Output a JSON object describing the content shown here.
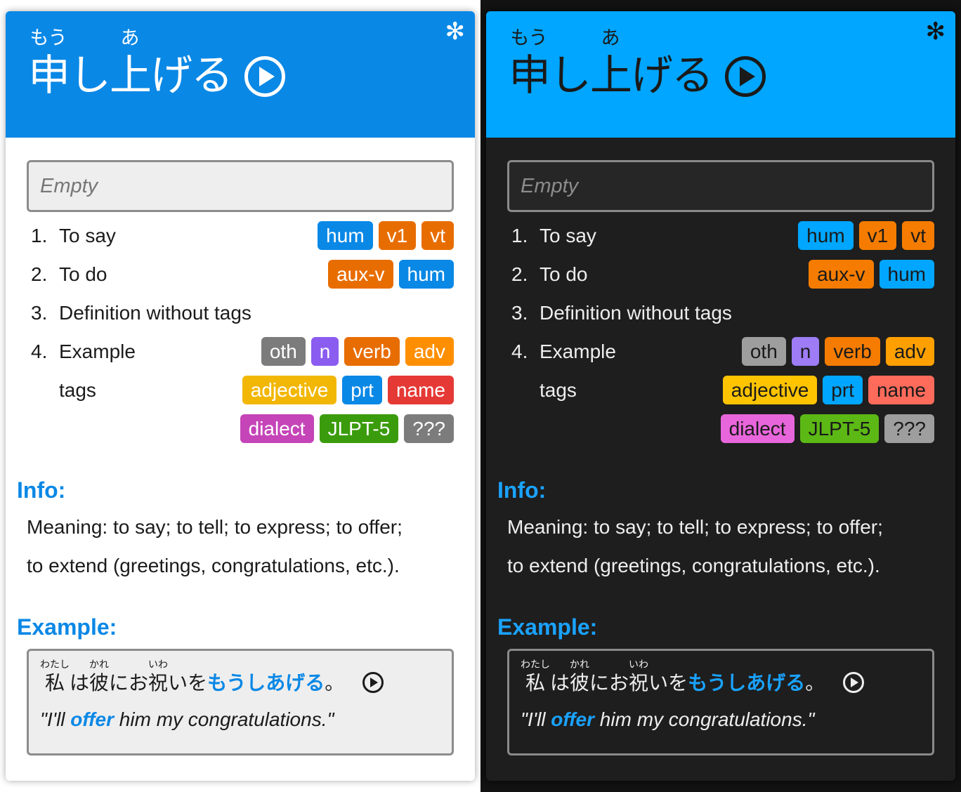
{
  "header": {
    "settings_icon": "✻",
    "word_groups": [
      {
        "furigana": "もう",
        "text": "申"
      },
      {
        "furigana": "",
        "text": "し"
      },
      {
        "furigana": "あ",
        "text": "上"
      },
      {
        "furigana": "",
        "text": "げる"
      }
    ],
    "play_icon": "play-circle-icon"
  },
  "answer_box": {
    "placeholder": "Empty"
  },
  "definitions": [
    {
      "num": "1.",
      "text": "To say",
      "tags": [
        {
          "label": "hum",
          "color": "#0a88e6",
          "dark_color": "#00a6ff"
        },
        {
          "label": "v1",
          "color": "#e86d00",
          "dark_color": "#f57c00"
        },
        {
          "label": "vt",
          "color": "#e86d00",
          "dark_color": "#f57c00"
        }
      ]
    },
    {
      "num": "2.",
      "text": "To do",
      "tags": [
        {
          "label": "aux-v",
          "color": "#e86d00",
          "dark_color": "#f57c00"
        },
        {
          "label": "hum",
          "color": "#0a88e6",
          "dark_color": "#00a6ff"
        }
      ]
    },
    {
      "num": "3.",
      "text": "Definition without tags",
      "tags": []
    },
    {
      "num": "4.",
      "text": "Example\ntags",
      "tags": [
        {
          "label": "oth",
          "color": "#7c7c7c",
          "dark_color": "#9e9e9e"
        },
        {
          "label": "n",
          "color": "#8b5cf0",
          "dark_color": "#9d7cf5"
        },
        {
          "label": "verb",
          "color": "#e86d00",
          "dark_color": "#f57c00"
        },
        {
          "label": "adv",
          "color": "#ff8f00",
          "dark_color": "#ffa000"
        },
        {
          "label": "adjective",
          "color": "#f2b705",
          "dark_color": "#ffc400"
        },
        {
          "label": "prt",
          "color": "#0a88e6",
          "dark_color": "#00a6ff"
        },
        {
          "label": "name",
          "color": "#e53935",
          "dark_color": "#ff6b5b"
        },
        {
          "label": "dialect",
          "color": "#c544b8",
          "dark_color": "#e866dc"
        },
        {
          "label": "JLPT-5",
          "color": "#3a9c0c",
          "dark_color": "#5cb815"
        },
        {
          "label": "???",
          "color": "#7c7c7c",
          "dark_color": "#9e9e9e"
        }
      ]
    }
  ],
  "info": {
    "title": "Info:",
    "line1": "Meaning: to say; to tell; to express; to offer;",
    "line2": "to extend (greetings, congratulations, etc.)."
  },
  "example": {
    "title": "Example:",
    "jp_groups": [
      {
        "furigana": "わたし",
        "text": "私",
        "highlight": false
      },
      {
        "furigana": "",
        "text": "は",
        "highlight": false
      },
      {
        "furigana": "かれ",
        "text": "彼",
        "highlight": false
      },
      {
        "furigana": "",
        "text": "にお",
        "highlight": false
      },
      {
        "furigana": "いわ",
        "text": "祝",
        "highlight": false
      },
      {
        "furigana": "",
        "text": "いを",
        "highlight": false
      },
      {
        "furigana": "",
        "text": "もうしあげる",
        "highlight": true
      },
      {
        "furigana": "",
        "text": "。",
        "highlight": false
      }
    ],
    "en_before": "\"I'll ",
    "en_highlight": "offer",
    "en_after": " him my congratulations.\""
  }
}
